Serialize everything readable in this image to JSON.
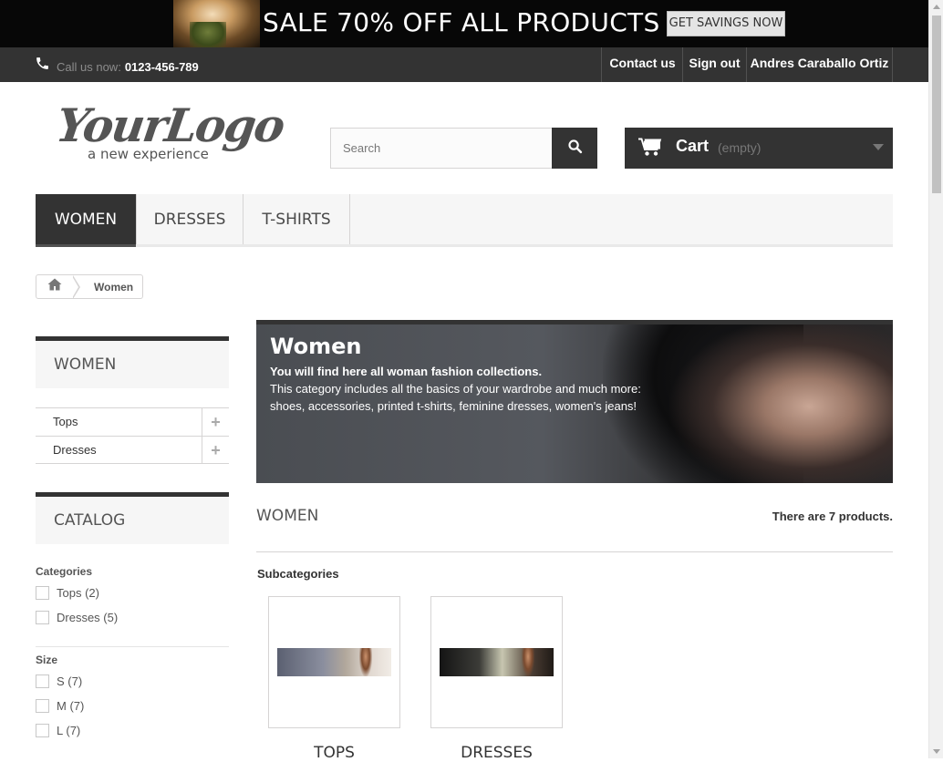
{
  "promo": {
    "headline": "SALE 70% OFF ALL PRODUCTS",
    "cta": "GET SAVINGS NOW"
  },
  "topbar": {
    "call_label": "Call us now:",
    "phone": "0123-456-789",
    "links": [
      "Contact us",
      "Sign out",
      "Andres Caraballo Ortiz"
    ]
  },
  "logo": {
    "main": "YourLogo",
    "tagline": "a new experience"
  },
  "search": {
    "placeholder": "Search"
  },
  "cart": {
    "label": "Cart",
    "status": "(empty)"
  },
  "menu": {
    "items": [
      "WOMEN",
      "DRESSES",
      "T-SHIRTS"
    ],
    "active": "WOMEN"
  },
  "breadcrumb": {
    "current": "Women"
  },
  "sidebar": {
    "category_title": "WOMEN",
    "categories": [
      "Tops",
      "Dresses"
    ],
    "catalog_title": "CATALOG",
    "filters": {
      "categories_label": "Categories",
      "categories": [
        "Tops (2)",
        "Dresses (5)"
      ],
      "size_label": "Size",
      "sizes": [
        "S (7)",
        "M (7)",
        "L (7)"
      ]
    }
  },
  "hero": {
    "title": "Women",
    "subtitle": "You will find here all woman fashion collections.",
    "line1": "This category includes all the basics of your wardrobe and much more:",
    "line2": "shoes, accessories, printed t-shirts, feminine dresses, women's jeans!"
  },
  "listing": {
    "title": "WOMEN",
    "count_text": "There are 7 products.",
    "subcategories_label": "Subcategories",
    "subcategories": [
      "TOPS",
      "DRESSES"
    ]
  },
  "colors": {
    "dark": "#333333",
    "panel": "#f6f6f6",
    "border": "#d6d4d4"
  }
}
